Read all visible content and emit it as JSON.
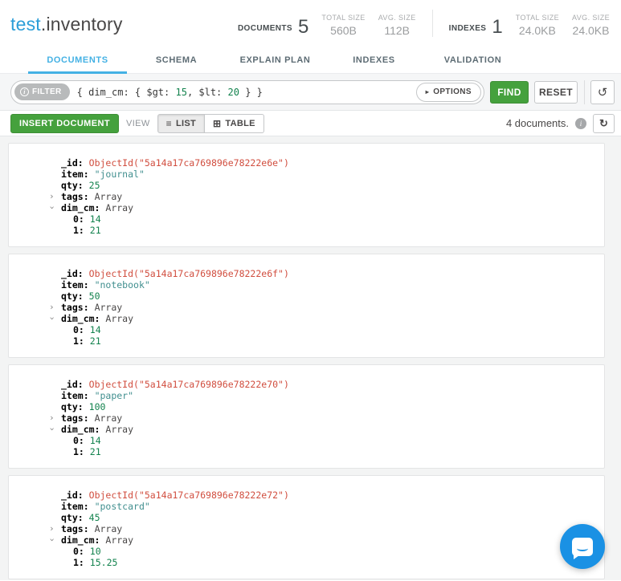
{
  "header": {
    "namespace": {
      "db": "test",
      "separator_and_collection": ".inventory"
    },
    "stats": {
      "documents_label": "DOCUMENTS",
      "documents_value": "5",
      "documents_total_size_label": "TOTAL SIZE",
      "documents_total_size": "560B",
      "documents_avg_size_label": "AVG. SIZE",
      "documents_avg_size": "112B",
      "indexes_label": "INDEXES",
      "indexes_value": "1",
      "indexes_total_size_label": "TOTAL SIZE",
      "indexes_total_size": "24.0KB",
      "indexes_avg_size_label": "AVG. SIZE",
      "indexes_avg_size": "24.0KB"
    }
  },
  "tabs": [
    {
      "label": "DOCUMENTS",
      "active": true
    },
    {
      "label": "SCHEMA",
      "active": false
    },
    {
      "label": "EXPLAIN PLAN",
      "active": false
    },
    {
      "label": "INDEXES",
      "active": false
    },
    {
      "label": "VALIDATION",
      "active": false
    }
  ],
  "filter_bar": {
    "filter_badge_label": "FILTER",
    "info_icon_glyph": "i",
    "query_segments": [
      {
        "text": "{ dim_cm: { $gt: ",
        "type": "plain"
      },
      {
        "text": "15",
        "type": "number"
      },
      {
        "text": ", $lt: ",
        "type": "plain"
      },
      {
        "text": "20",
        "type": "number"
      },
      {
        "text": " } }",
        "type": "plain"
      }
    ],
    "options_label": "OPTIONS",
    "options_caret_glyph": "▸",
    "find_label": "FIND",
    "reset_label": "RESET",
    "history_icon_glyph": "↺"
  },
  "doc_toolbar": {
    "insert_label": "INSERT DOCUMENT",
    "view_label": "VIEW",
    "list_label": "LIST",
    "list_icon_glyph": "≡",
    "table_label": "TABLE",
    "table_icon_glyph": "⊞",
    "count_text": "4 documents.",
    "info_icon_glyph": "i",
    "refresh_icon_glyph": "↻"
  },
  "documents": [
    {
      "fields": [
        {
          "indent": 0,
          "chevron": null,
          "key": "_id",
          "value": "ObjectId(\"5a14a17ca769896e78222e6e\")",
          "type": "objectid"
        },
        {
          "indent": 0,
          "chevron": null,
          "key": "item",
          "value": "\"journal\"",
          "type": "string"
        },
        {
          "indent": 0,
          "chevron": null,
          "key": "qty",
          "value": "25",
          "type": "number"
        },
        {
          "indent": 0,
          "chevron": "collapsed",
          "key": "tags",
          "value": "Array",
          "type": "plain"
        },
        {
          "indent": 0,
          "chevron": "expanded",
          "key": "dim_cm",
          "value": "Array",
          "type": "plain"
        },
        {
          "indent": 1,
          "chevron": null,
          "key": "0",
          "value": "14",
          "type": "number"
        },
        {
          "indent": 1,
          "chevron": null,
          "key": "1",
          "value": "21",
          "type": "number"
        }
      ]
    },
    {
      "fields": [
        {
          "indent": 0,
          "chevron": null,
          "key": "_id",
          "value": "ObjectId(\"5a14a17ca769896e78222e6f\")",
          "type": "objectid"
        },
        {
          "indent": 0,
          "chevron": null,
          "key": "item",
          "value": "\"notebook\"",
          "type": "string"
        },
        {
          "indent": 0,
          "chevron": null,
          "key": "qty",
          "value": "50",
          "type": "number"
        },
        {
          "indent": 0,
          "chevron": "collapsed",
          "key": "tags",
          "value": "Array",
          "type": "plain"
        },
        {
          "indent": 0,
          "chevron": "expanded",
          "key": "dim_cm",
          "value": "Array",
          "type": "plain"
        },
        {
          "indent": 1,
          "chevron": null,
          "key": "0",
          "value": "14",
          "type": "number"
        },
        {
          "indent": 1,
          "chevron": null,
          "key": "1",
          "value": "21",
          "type": "number"
        }
      ]
    },
    {
      "fields": [
        {
          "indent": 0,
          "chevron": null,
          "key": "_id",
          "value": "ObjectId(\"5a14a17ca769896e78222e70\")",
          "type": "objectid"
        },
        {
          "indent": 0,
          "chevron": null,
          "key": "item",
          "value": "\"paper\"",
          "type": "string"
        },
        {
          "indent": 0,
          "chevron": null,
          "key": "qty",
          "value": "100",
          "type": "number"
        },
        {
          "indent": 0,
          "chevron": "collapsed",
          "key": "tags",
          "value": "Array",
          "type": "plain"
        },
        {
          "indent": 0,
          "chevron": "expanded",
          "key": "dim_cm",
          "value": "Array",
          "type": "plain"
        },
        {
          "indent": 1,
          "chevron": null,
          "key": "0",
          "value": "14",
          "type": "number"
        },
        {
          "indent": 1,
          "chevron": null,
          "key": "1",
          "value": "21",
          "type": "number"
        }
      ]
    },
    {
      "fields": [
        {
          "indent": 0,
          "chevron": null,
          "key": "_id",
          "value": "ObjectId(\"5a14a17ca769896e78222e72\")",
          "type": "objectid"
        },
        {
          "indent": 0,
          "chevron": null,
          "key": "item",
          "value": "\"postcard\"",
          "type": "string"
        },
        {
          "indent": 0,
          "chevron": null,
          "key": "qty",
          "value": "45",
          "type": "number"
        },
        {
          "indent": 0,
          "chevron": "collapsed",
          "key": "tags",
          "value": "Array",
          "type": "plain"
        },
        {
          "indent": 0,
          "chevron": "expanded",
          "key": "dim_cm",
          "value": "Array",
          "type": "plain"
        },
        {
          "indent": 1,
          "chevron": null,
          "key": "0",
          "value": "10",
          "type": "number"
        },
        {
          "indent": 1,
          "chevron": null,
          "key": "1",
          "value": "15.25",
          "type": "number"
        }
      ]
    }
  ],
  "colors": {
    "accent_blue": "#44b1e4",
    "title_db_blue": "#2c9ed8",
    "button_green": "#45a13d",
    "objectid_red": "#d14e3f",
    "string_teal": "#418f8f",
    "number_green": "#12824d",
    "intercom_blue": "#1a91e4"
  }
}
